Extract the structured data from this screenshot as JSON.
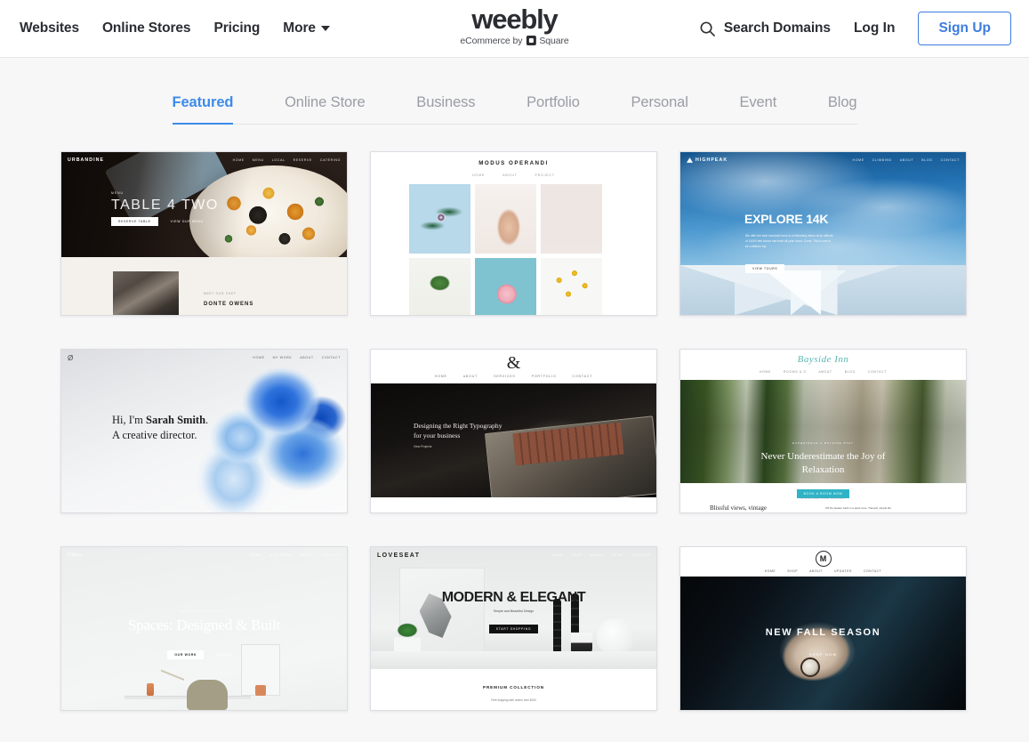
{
  "header": {
    "nav_left": [
      {
        "label": "Websites",
        "name": "nav-websites"
      },
      {
        "label": "Online Stores",
        "name": "nav-online-stores"
      },
      {
        "label": "Pricing",
        "name": "nav-pricing"
      },
      {
        "label": "More",
        "name": "nav-more"
      }
    ],
    "logo": {
      "wordmark": "weebly",
      "tagline_before": "eCommerce by",
      "tagline_after": "Square"
    },
    "search_domains_label": "Search Domains",
    "login_label": "Log In",
    "signup_label": "Sign Up",
    "accent_blue": "#3d7ce0"
  },
  "tabs": {
    "active_index": 0,
    "active_color": "#3c8bea",
    "items": [
      {
        "label": "Featured",
        "name": "tab-featured"
      },
      {
        "label": "Online Store",
        "name": "tab-online-store"
      },
      {
        "label": "Business",
        "name": "tab-business"
      },
      {
        "label": "Portfolio",
        "name": "tab-portfolio"
      },
      {
        "label": "Personal",
        "name": "tab-personal"
      },
      {
        "label": "Event",
        "name": "tab-event"
      },
      {
        "label": "Blog",
        "name": "tab-blog"
      }
    ]
  },
  "templates": [
    {
      "id": "urbandine",
      "brand": "URBANDINE",
      "nav": [
        "HOME",
        "MENU",
        "LOCAL",
        "RESERVE",
        "CATERING"
      ],
      "headline": "TABLE 4 TWO",
      "eyebrow": "MENU",
      "buttons": [
        "RESERVE TABLE",
        "VIEW OUR MENU"
      ],
      "section_eyebrow": "MEET OUR CHEF",
      "section_title": "DONTE OWENS"
    },
    {
      "id": "modus-operandi",
      "brand": "MODUS OPERANDI",
      "nav": [
        "HOME",
        "ABOUT",
        "PROJECT"
      ],
      "headline": "",
      "gallery_cells": 6
    },
    {
      "id": "highpeak",
      "brand": "HIGHPEAK",
      "nav": [
        "HOME",
        "CLIMBING",
        "ABOUT",
        "BLOG",
        "CONTACT"
      ],
      "headline": "EXPLORE 14K",
      "body": "We offer the best mountain tours to exhilarating hikers at an altitude of 14000 feet above sea level all year round. Come. This is one to be a lifetime trip.",
      "button": "VIEW TOURS"
    },
    {
      "id": "sarah-smith",
      "brand": "Ø",
      "nav": [
        "HOME",
        "MY WORK",
        "ABOUT",
        "CONTACT"
      ],
      "headline_pre": "Hi, I'm ",
      "headline_bold_1": "Sarah Smith",
      "headline_post": ". A creative director."
    },
    {
      "id": "typography",
      "brand": "&",
      "nav": [
        "HOME",
        "ABOUT",
        "SERVICES",
        "PORTFOLIO",
        "CONTACT"
      ],
      "headline_line1": "Designing the Right Typography",
      "headline_line2": "for your business",
      "link": "View Projects"
    },
    {
      "id": "bayside-inn",
      "brand": "Bayside Inn",
      "nav": [
        "HOME",
        "ROOMS & S",
        "ABOUT",
        "BLOG",
        "CONTACT"
      ],
      "eyebrow": "EXPERIENCE A BAYSIDE STAY",
      "headline_line1": "Never Underestimate the  Joy of",
      "headline_line2": "Relaxation",
      "button": "BOOK A ROOM NOW",
      "section_eyebrow": "DISCOVER OUR SPACES",
      "section_title": "Blissful views, vintage",
      "section_body": "Off the beaten track in a quiet cove. Tranquil, simple life."
    },
    {
      "id": "oikos",
      "brand": "Oikos",
      "nav": [
        "HOME",
        "OUR WORK",
        "ABOUT",
        "CONTACT"
      ],
      "eyebrow": "INTERIOR ARCHITECTS",
      "headline": "Spaces: Designed & Built",
      "buttons": [
        "OUR WORK",
        "CONTACT"
      ]
    },
    {
      "id": "loveseat",
      "brand": "LOVESEAT",
      "nav": [
        "HOME",
        "SHOP",
        "ABOUT",
        "BLOG",
        "CONTACT"
      ],
      "headline": "MODERN & ELEGANT",
      "subhead": "Simple and Beautiful Design",
      "button": "START SHOPPING",
      "section_title": "PREMIUM COLLECTION",
      "section_body": "Free shipping with orders over $100"
    },
    {
      "id": "new-fall-season",
      "brand": "M",
      "nav": [
        "HOME",
        "SHOP",
        "ABOUT",
        "UPDATES",
        "CONTACT"
      ],
      "headline": "NEW FALL SEASON",
      "button": "SHOP NOW"
    }
  ]
}
